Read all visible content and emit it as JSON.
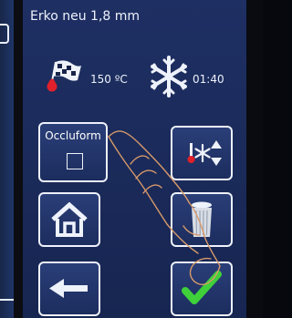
{
  "header": {
    "title": "Erko neu 1,8 mm"
  },
  "status": {
    "heating_icon": "checkered-flag-heat-icon",
    "temperature": "150 ºC",
    "cooling_icon": "snowflake-icon",
    "cooling_time": "01:40"
  },
  "buttons": {
    "occluform_label": "Occluform",
    "occluform_checked": false,
    "temp_icon": "temperature-snowflake-updown-icon",
    "home_icon": "home-icon",
    "trash_icon": "trash-can-icon",
    "back_icon": "arrow-left-icon",
    "confirm_icon": "checkmark-icon"
  },
  "colors": {
    "screen_bg": "#1b2b5b",
    "text": "#eef2fb",
    "confirm_green": "#3fd03a",
    "heat_red": "#e0202a"
  }
}
